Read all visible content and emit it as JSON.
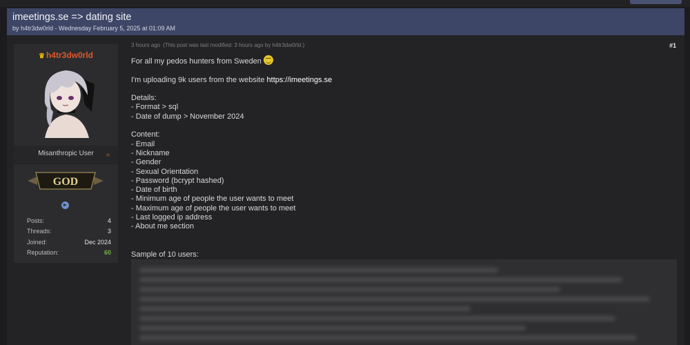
{
  "thread": {
    "title": "imeetings.se => dating site",
    "meta": "by h4tr3dw0rld - Wednesday February 5, 2025 at 01:09 AM"
  },
  "user": {
    "username": "h4tr3dw0rld",
    "title": "Misanthropic User",
    "badge": "GOD",
    "stats": [
      {
        "label": "Posts:",
        "value": "4"
      },
      {
        "label": "Threads:",
        "value": "3"
      },
      {
        "label": "Joined:",
        "value": "Dec 2024"
      },
      {
        "label": "Reputation:",
        "value": "60"
      }
    ],
    "reputation_color": "#6db33f",
    "username_color": "#e0592a"
  },
  "post": {
    "time": "3 hours ago",
    "modified": "(This post was last modified: 3 hours ago by h4tr3dw0rld.)",
    "number": "#1",
    "intro": "For all my pedos hunters from Sweden",
    "upload_text": "I'm uploading 9k users from the website ",
    "upload_link": "https://imeetings.se",
    "details_heading": "Details:",
    "details": [
      "- Format > sql",
      "- Date of dump > November 2024"
    ],
    "content_heading": "Content:",
    "content": [
      "- Email",
      "- Nickname",
      "- Gender",
      "- Sexual Orientation",
      "- Password (bcrypt hashed)",
      "- Date of birth",
      "- Minimum age of people the user wants to meet",
      "- Maximum age of people the user wants to meet",
      "- Last logged ip address",
      "- About me section"
    ],
    "sample_label": "Sample of 10 users:"
  },
  "icons": {
    "crown": "crown-icon",
    "telegram": "telegram-icon",
    "emoji": "grin-emoji-icon",
    "status": "offline-status-icon"
  },
  "colors": {
    "header_bg": "#3d4666",
    "page_bg": "#1c1c1e"
  }
}
